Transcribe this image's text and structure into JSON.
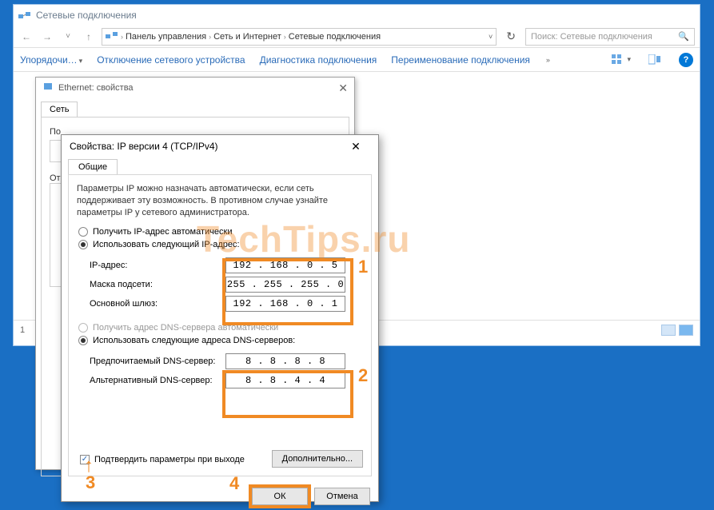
{
  "explorer": {
    "title": "Сетевые подключения",
    "breadcrumb": [
      "Панель управления",
      "Сеть и Интернет",
      "Сетевые подключения"
    ],
    "search_placeholder": "Поиск: Сетевые подключения",
    "cmd": {
      "organize": "Упорядочи…",
      "disable": "Отключение сетевого устройства",
      "diagnose": "Диагностика подключения",
      "rename": "Переименование подключения"
    },
    "status_count": "1"
  },
  "eth": {
    "title": "Ethernet: свойства",
    "tab": "Сеть",
    "connect_using": "По",
    "items_label": "От"
  },
  "ipv4": {
    "title": "Свойства: IP версии 4 (TCP/IPv4)",
    "tab": "Общие",
    "paragraph": "Параметры IP можно назначать автоматически, если сеть поддерживает эту возможность. В противном случае узнайте параметры IP у сетевого администратора.",
    "radio_auto_ip": "Получить IP-адрес автоматически",
    "radio_manual_ip": "Использовать следующий IP-адрес:",
    "ip_label": "IP-адрес:",
    "mask_label": "Маска подсети:",
    "gw_label": "Основной шлюз:",
    "ip_value": "192 . 168 .  0  .  5",
    "mask_value": "255 . 255 . 255 .  0",
    "gw_value": "192 . 168 .  0  .  1",
    "radio_auto_dns": "Получить адрес DNS-сервера автоматически",
    "radio_manual_dns": "Использовать следующие адреса DNS-серверов:",
    "dns1_label": "Предпочитаемый DNS-сервер:",
    "dns2_label": "Альтернативный DNS-сервер:",
    "dns1_value": " 8  .  8  .  8  .  8",
    "dns2_value": " 8  .  8  .  4  .  4",
    "validate_checkbox": "Подтвердить параметры при выходе",
    "advanced_btn": "Дополнительно...",
    "ok_btn": "ОК",
    "cancel_btn": "Отмена"
  },
  "annotations": {
    "n1": "1",
    "n2": "2",
    "n3": "3",
    "n4": "4",
    "arrow": "↑"
  },
  "watermark": "TechTips.ru"
}
